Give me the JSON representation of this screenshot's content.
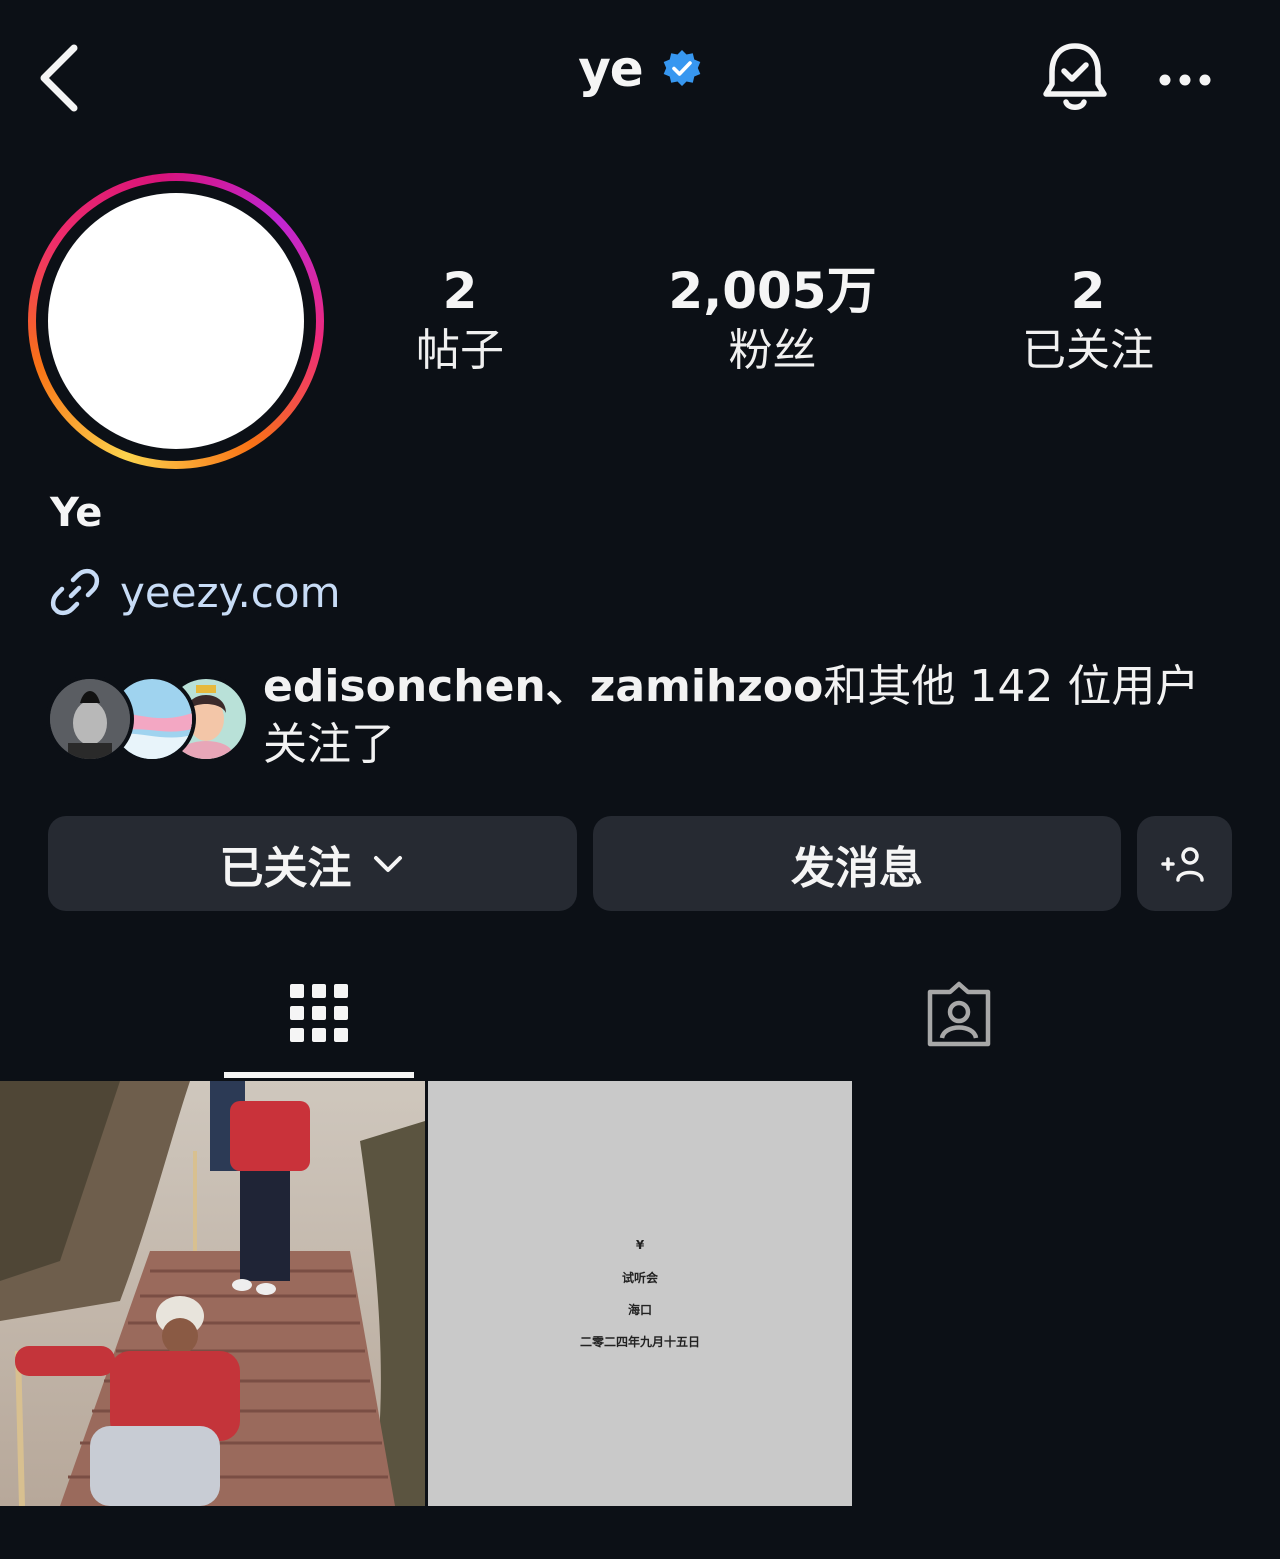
{
  "header": {
    "username": "ye",
    "icons": {
      "back": "chevron-left-icon",
      "verified": "verified-badge-icon",
      "notifications": "bell-check-icon",
      "more": "more-horizontal-icon"
    }
  },
  "profile": {
    "display_name": "Ye",
    "link": "yeezy.com",
    "stats": [
      {
        "value": "2",
        "label": "帖子"
      },
      {
        "value": "2,005万",
        "label": "粉丝"
      },
      {
        "value": "2",
        "label": "已关注"
      }
    ]
  },
  "followed_by": {
    "names": "edisonchen、zamihzoo",
    "rest": "和其他 142 位用户关注了"
  },
  "actions": {
    "following_label": "已关注",
    "message_label": "发消息",
    "add_user_icon": "add-person-icon"
  },
  "tabs": [
    {
      "name": "posts-grid",
      "icon": "grid-icon",
      "active": true
    },
    {
      "name": "tagged",
      "icon": "tagged-person-icon",
      "active": false
    }
  ],
  "posts": [
    {
      "kind": "photo",
      "description_icon": "photo-stairs"
    },
    {
      "kind": "poster",
      "lines": [
        "¥",
        "试听会",
        "海口",
        "二零二四年九月十五日"
      ]
    }
  ],
  "colors": {
    "background": "#0c1016",
    "button": "#262a32",
    "link": "#c8dcf6",
    "verified": "#3797f0"
  }
}
